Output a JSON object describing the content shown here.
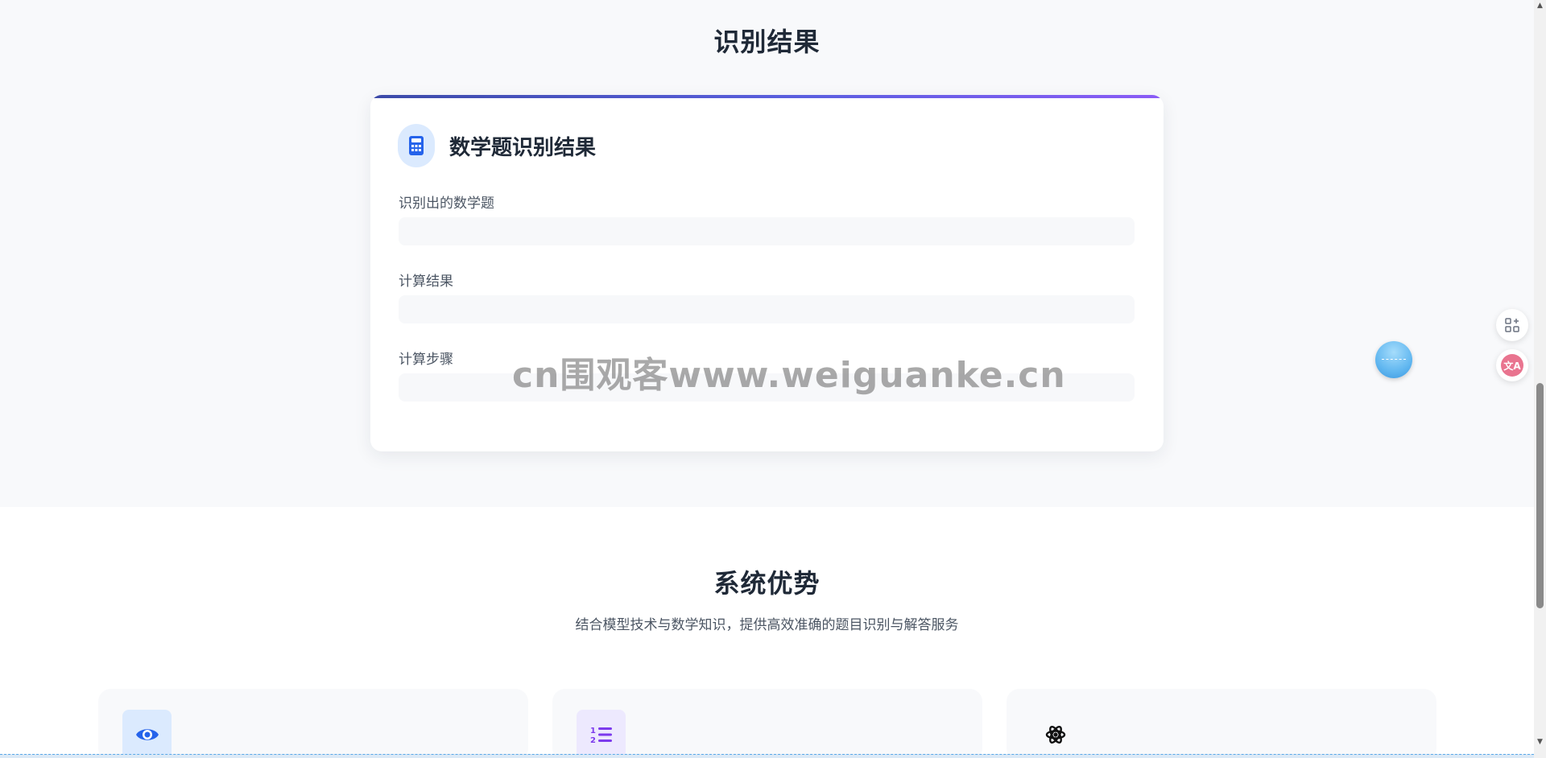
{
  "results": {
    "section_title": "识别结果",
    "card": {
      "title": "数学题识别结果",
      "icon": "calculator-icon",
      "fields": [
        {
          "label": "识别出的数学题",
          "value": ""
        },
        {
          "label": "计算结果",
          "value": ""
        },
        {
          "label": "计算步骤",
          "value": ""
        }
      ]
    }
  },
  "advantages": {
    "title": "系统优势",
    "subtitle": "结合模型技术与数学知识，提供高效准确的题目识别与解答服务",
    "cards": [
      {
        "icon": "eye-icon",
        "icon_color": "#2563eb",
        "icon_bg": "#dbeafe"
      },
      {
        "icon": "numbered-list-icon",
        "icon_color": "#7c3aed",
        "icon_bg": "#ede9fe"
      },
      {
        "icon": "atom-icon",
        "icon_color": "#111111",
        "icon_bg": "transparent"
      }
    ]
  },
  "watermark": "cn围观客www.weiguanke.cn",
  "side_tools": {
    "translate_label": "文A"
  },
  "colors": {
    "accent": "#1e88e5",
    "gradient_start": "#3b4aa8",
    "gradient_end": "#8b5cf6"
  }
}
